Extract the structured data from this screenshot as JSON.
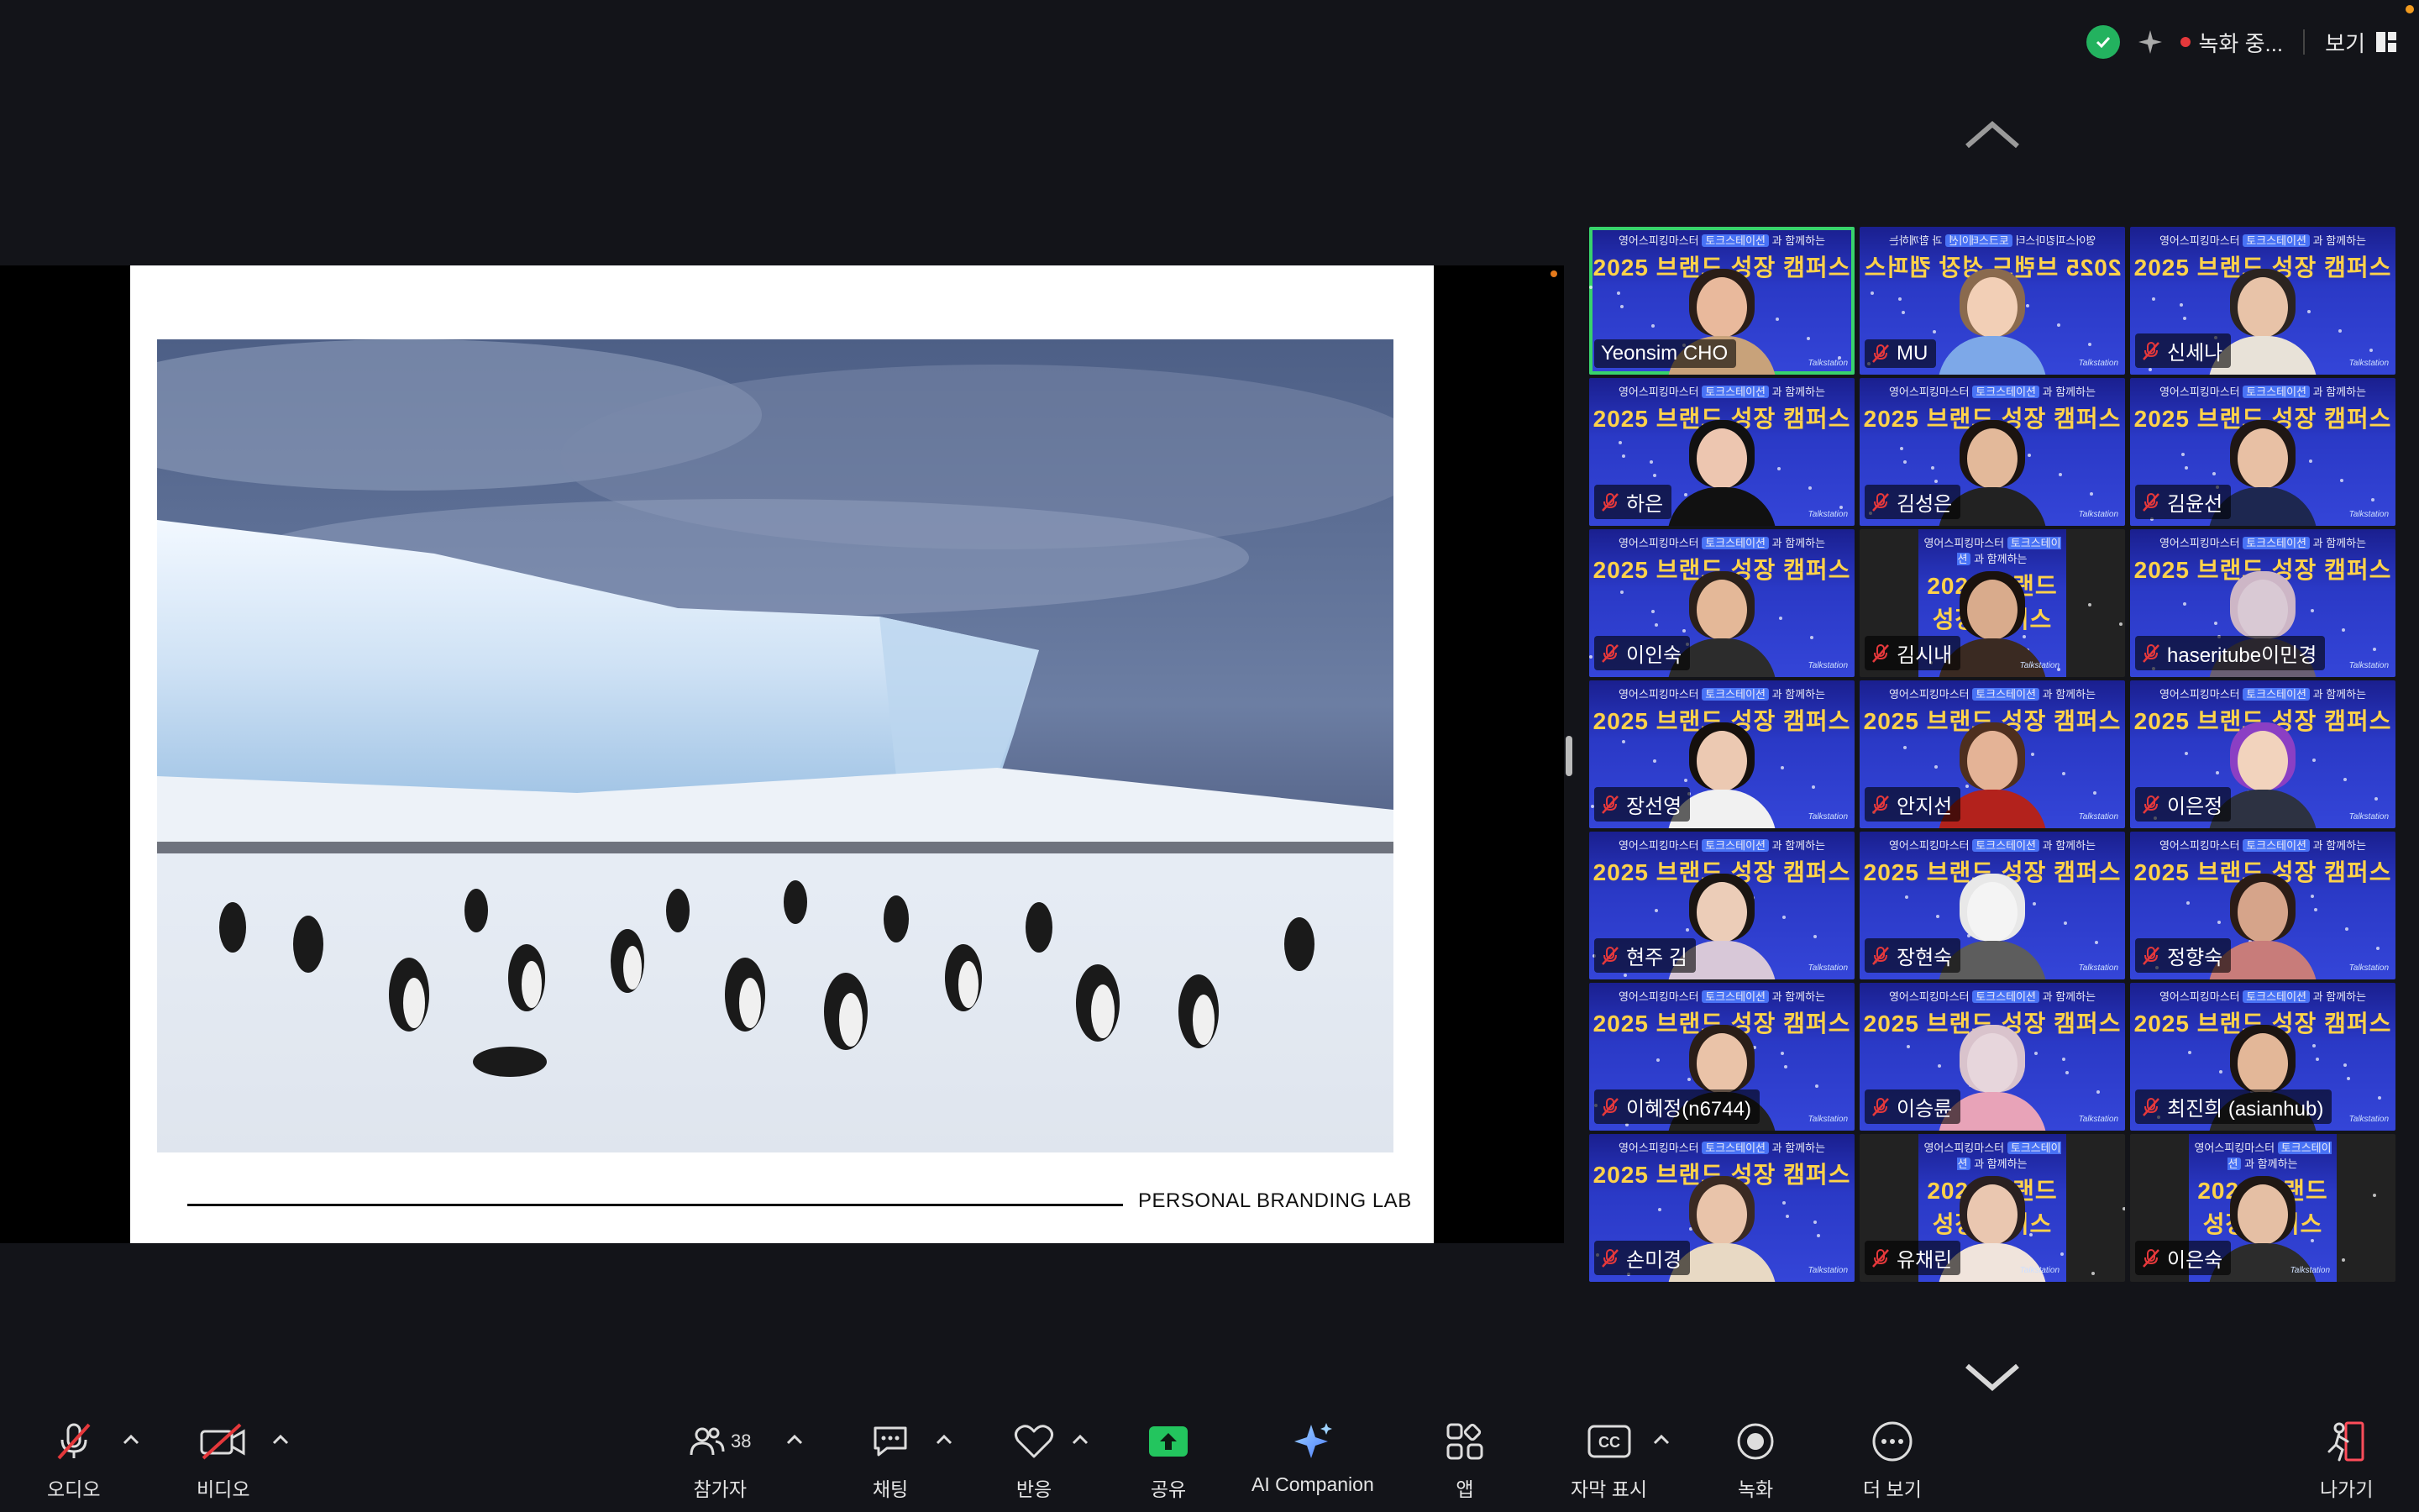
{
  "topbar": {
    "recording_label": "녹화 중...",
    "view_label": "보기",
    "colors": {
      "shield": "#23b25f",
      "rec": "#e5383b"
    }
  },
  "slide": {
    "footer_text": "PERSONAL BRANDING LAB",
    "photo_description_icon": "penguin-colony-photo"
  },
  "gallery": {
    "banner_sub_prefix": "영어스피킹마스터",
    "banner_sub_highlight": "토크스테이션",
    "banner_sub_suffix": "과 함께하는",
    "banner_main": "2025 브랜드 성장 캠퍼스",
    "logo": "Talkstation",
    "participants": [
      {
        "name": "Yeonsim CHO",
        "muted": false,
        "active": true,
        "skin": "#e9b99c",
        "hair": "#2a1d17",
        "shirt": "#c8a27a"
      },
      {
        "name": "MU",
        "muted": true,
        "active": false,
        "skin": "#f2cfb6",
        "hair": "#8a6a4e",
        "shirt": "#7da8e8",
        "mirrored": true
      },
      {
        "name": "신세나",
        "muted": true,
        "active": false,
        "skin": "#e8c3a8",
        "hair": "#2b2420",
        "shirt": "#e8e2d8"
      },
      {
        "name": "하은",
        "muted": true,
        "active": false,
        "skin": "#edc6b0",
        "hair": "#111",
        "shirt": "#111"
      },
      {
        "name": "김성은",
        "muted": true,
        "active": false,
        "skin": "#e3b99a",
        "hair": "#1b1410",
        "shirt": "#222"
      },
      {
        "name": "김윤선",
        "muted": true,
        "active": false,
        "skin": "#e8c0a4",
        "hair": "#1f1714",
        "shirt": "#1d2750"
      },
      {
        "name": "이인숙",
        "muted": true,
        "active": false,
        "skin": "#e4b898",
        "hair": "#2a201a",
        "shirt": "#2c2c2c"
      },
      {
        "name": "김시내",
        "muted": true,
        "active": false,
        "skin": "#d9ab8c",
        "hair": "#1a120e",
        "shirt": "#3a2a22",
        "narrow": true
      },
      {
        "name": "haseritube이민경",
        "muted": true,
        "active": false,
        "skin": "#d9c9d4",
        "hair": "#cdb6c6",
        "shirt": "#6a5f73"
      },
      {
        "name": "장선영",
        "muted": true,
        "active": false,
        "skin": "#ecc9b2",
        "hair": "#15100d",
        "shirt": "#f1f1f1"
      },
      {
        "name": "안지선",
        "muted": true,
        "active": false,
        "skin": "#e4b396",
        "hair": "#4e2f1f",
        "shirt": "#b3221c"
      },
      {
        "name": "이은정",
        "muted": true,
        "active": false,
        "skin": "#f2d3bd",
        "hair": "#8b3fc4",
        "shirt": "#2d3242"
      },
      {
        "name": "현주 김",
        "muted": true,
        "active": false,
        "skin": "#eccdb8",
        "hair": "#1a1512",
        "shirt": "#d8c8d8"
      },
      {
        "name": "장현숙",
        "muted": true,
        "active": false,
        "skin": "#f4f4f4",
        "hair": "#e8e8e8",
        "shirt": "#5d5d5d"
      },
      {
        "name": "정향숙",
        "muted": true,
        "active": false,
        "skin": "#d6a48a",
        "hair": "#2b1c16",
        "shirt": "#c87c7a"
      },
      {
        "name": "이혜정(n6744)",
        "muted": true,
        "active": false,
        "skin": "#eac3a8",
        "hair": "#2a1e18",
        "shirt": "#222"
      },
      {
        "name": "이승륜",
        "muted": true,
        "active": false,
        "skin": "#e7d6dc",
        "hair": "#d9c3cc",
        "shirt": "#e8a3b8"
      },
      {
        "name": "최진희 (asianhub)",
        "muted": true,
        "active": false,
        "skin": "#e3b798",
        "hair": "#1c1512",
        "shirt": "#2a2a2a"
      },
      {
        "name": "손미경",
        "muted": true,
        "active": false,
        "skin": "#e9c4aa",
        "hair": "#3a2a22",
        "shirt": "#e8d9c4"
      },
      {
        "name": "유채린",
        "muted": true,
        "active": false,
        "skin": "#eac7b0",
        "hair": "#2a2020",
        "shirt": "#f0e4dc",
        "narrow": true
      },
      {
        "name": "이은숙",
        "muted": true,
        "active": false,
        "skin": "#e5bfa4",
        "hair": "#1f1814",
        "shirt": "#2c2c2c",
        "narrow": true
      }
    ]
  },
  "toolbar": {
    "audio": "오디오",
    "video": "비디오",
    "participants": "참가자",
    "participant_count": "38",
    "chat": "채팅",
    "reactions": "반응",
    "share": "공유",
    "ai_companion": "AI Companion",
    "apps": "앱",
    "captions": "자막 표시",
    "record": "녹화",
    "more": "더 보기",
    "leave": "나가기",
    "colors": {
      "share": "#23c55e",
      "leave": "#ff4d5a",
      "muted": "#e5383b"
    }
  }
}
